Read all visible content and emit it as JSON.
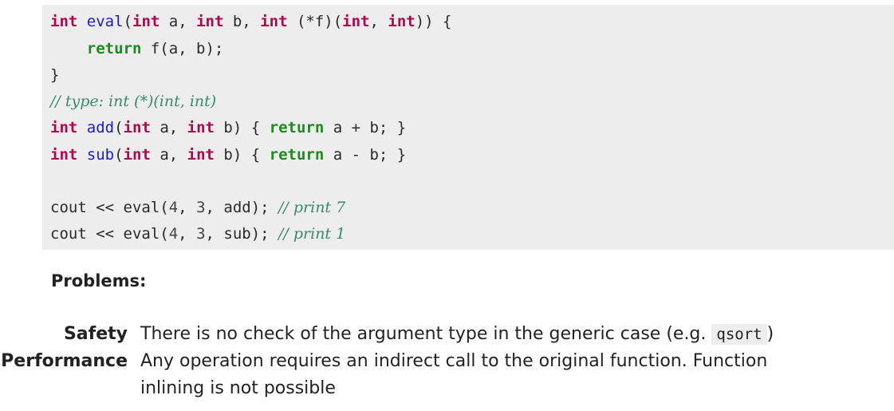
{
  "code": {
    "line1": {
      "kw1": "int",
      "sp1": " ",
      "fn": "eval",
      "p1": "(",
      "kw2": "int",
      "t1": " a, ",
      "kw3": "int",
      "t2": " b, ",
      "kw4": "int",
      "t3": " (*f)(",
      "kw5": "int",
      "t4": ", ",
      "kw6": "int",
      "t5": ")) {"
    },
    "line2": {
      "indent": "    ",
      "ret": "return",
      "rest": " f(a, b);"
    },
    "line3": {
      "text": "}"
    },
    "line4": {
      "comment": "// type: int (*)(int, int)"
    },
    "line5": {
      "kw1": "int",
      "sp": " ",
      "fn": "add",
      "p": "(",
      "kw2": "int",
      "t1": " a, ",
      "kw3": "int",
      "t2": " b) { ",
      "ret": "return",
      "t3": " a + b; }"
    },
    "line6": {
      "kw1": "int",
      "sp": " ",
      "fn": "sub",
      "p": "(",
      "kw2": "int",
      "t1": " a, ",
      "kw3": "int",
      "t2": " b) { ",
      "ret": "return",
      "t3": " a - b; }"
    },
    "line7": {
      "t1": "cout << eval(",
      "n1": "4",
      "t2": ", ",
      "n2": "3",
      "t3": ", add); ",
      "comment": "// print 7"
    },
    "line8": {
      "t1": "cout << eval(",
      "n1": "4",
      "t2": ", ",
      "n2": "3",
      "t3": ", sub); ",
      "comment": "// print 1"
    }
  },
  "problems": {
    "title": "Problems:",
    "items": [
      {
        "term": "Safety",
        "desc_before": "There is no check of the argument type in the generic case (e.g. ",
        "code": "qsort",
        "desc_after": ")"
      },
      {
        "term": "Performance",
        "line1": "Any operation requires an indirect call to the original function. Function",
        "line2": "inlining is not possible"
      }
    ]
  }
}
